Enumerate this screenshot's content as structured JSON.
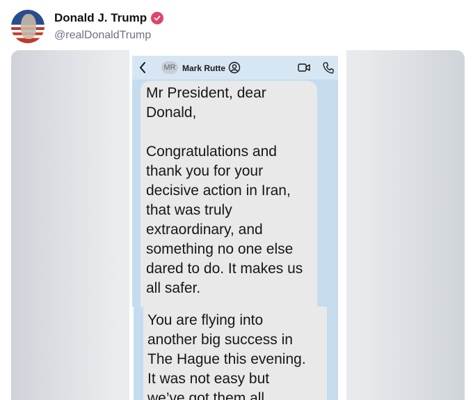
{
  "post": {
    "display_name": "Donald J. Trump",
    "handle": "@realDonaldTrump",
    "verified": true,
    "avatar_icon": "avatar-flag-portrait",
    "colors": {
      "verified": "#e0446b"
    }
  },
  "screenshot": {
    "chat_header": {
      "initials": "MR",
      "contact_name": "Mark Rutte",
      "icons": [
        "back-chevron-icon",
        "contact-info-icon",
        "video-call-icon",
        "phone-call-icon"
      ]
    },
    "messages": [
      {
        "text": "Mr President, dear\nDonald,\n\nCongratulations and\nthank you for your\ndecisive action in Iran,\nthat was truly\nextraordinary, and\nsomething no one else\ndared to do.  It makes us\nall safer."
      },
      {
        "text": "You are flying into\nanother big success in\nThe Hague this evening.\nIt was not easy but\nwe’ve got them all"
      }
    ],
    "colors": {
      "chat_background": "#c5dcef",
      "bubble": "#e9e9ea"
    }
  }
}
